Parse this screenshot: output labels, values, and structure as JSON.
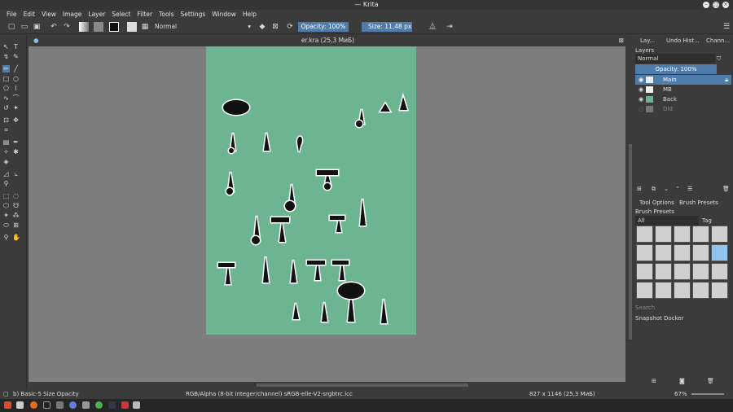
{
  "window": {
    "title": "— Krita"
  },
  "menu": [
    "File",
    "Edit",
    "View",
    "Image",
    "Layer",
    "Select",
    "Filter",
    "Tools",
    "Settings",
    "Window",
    "Help"
  ],
  "toolbar": {
    "blend_mode": "Normal",
    "opacity": "Opacity: 100%",
    "size": "Size: 11,48 px"
  },
  "document": {
    "tab_title": "er.kra (25,3 МиБ)"
  },
  "dock": {
    "tabs": [
      "Lay...",
      "Undo Hist...",
      "Chann..."
    ],
    "panel_title": "Layers",
    "blend_mode": "Normal",
    "opacity": "Opacity:  100%",
    "layers": [
      {
        "name": "Main",
        "selected": true
      },
      {
        "name": "МВ",
        "selected": false
      },
      {
        "name": "Back",
        "selected": false
      },
      {
        "name": "Old",
        "selected": false
      }
    ],
    "tool_tabs": [
      "Tool Options",
      "Brush Presets"
    ],
    "brush_presets_title": "Brush Presets",
    "filter": "All",
    "tag": "Tag",
    "search_placeholder": "Search",
    "snapshot": "Snapshot Docker"
  },
  "status": {
    "preset": "b) Basic-5 Size Opacity",
    "color_space": "RGB/Alpha (8-bit integer/channel)  sRGB-elle-V2-srgbtrc.icc",
    "dimensions": "827 x 1146 (25,3 МиБ)",
    "zoom": "67%"
  }
}
